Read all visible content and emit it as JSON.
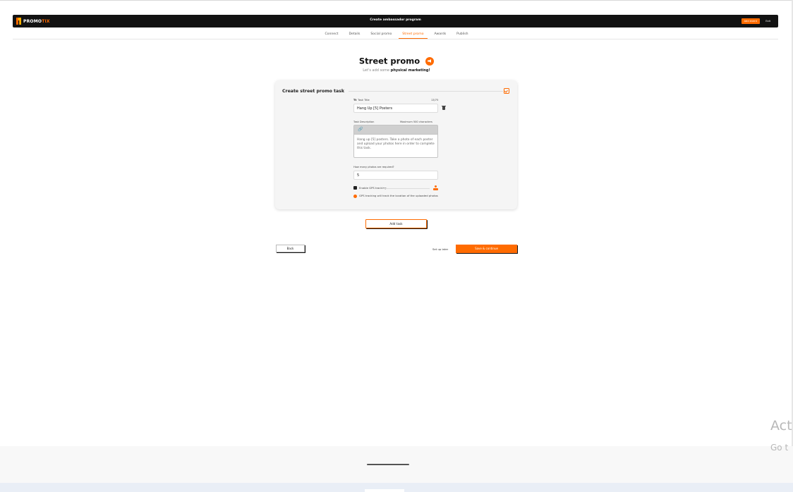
{
  "header": {
    "logo_text_white": "PROMO",
    "logo_text_orange": "TIX",
    "title": "Create ambassador program",
    "add_event_label": "Add event",
    "exit_label": "Exit"
  },
  "tabs": [
    {
      "label": "Connect",
      "active": false
    },
    {
      "label": "Details",
      "active": false
    },
    {
      "label": "Social promo",
      "active": false
    },
    {
      "label": "Street promo",
      "active": true
    },
    {
      "label": "Awards",
      "active": false
    },
    {
      "label": "Publish",
      "active": false
    }
  ],
  "page": {
    "title": "Street promo",
    "subtitle_prefix": "Let's add some",
    "subtitle_bold": "physical marketing!"
  },
  "card": {
    "title": "Create street promo task",
    "task_title_label": "Task Title",
    "task_title_icon": "Tt",
    "task_title_counter": "13/75",
    "task_title_value": "Hang Up [5] Posters",
    "description_label": "Task Description",
    "description_limit": "Maximum 500 characters",
    "description_value": "Hang up [5] posters. Take a photo of each poster and upload your photos here in order to complete this task.",
    "photos_label": "How many photos are required?",
    "photos_value": "5",
    "gps_label": "Enable GPS tracking",
    "gps_enabled": true,
    "gps_info": "GPS tracking will track the location of the uploaded photos"
  },
  "actions": {
    "add_task_label": "Add task",
    "back_label": "Back",
    "setup_later_label": "Set up later",
    "save_continue_label": "Save & continue"
  },
  "overlay": {
    "activate_line1": "Act",
    "activate_line2": "Go t"
  },
  "colors": {
    "accent": "#ff6b00",
    "header_bg": "#121212",
    "card_bg": "#f5f5f5"
  }
}
